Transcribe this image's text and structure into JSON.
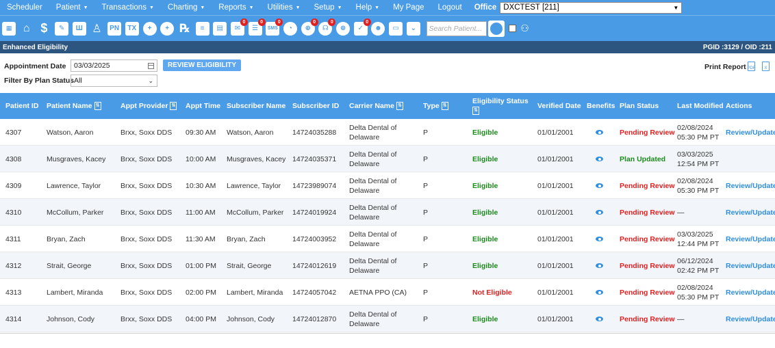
{
  "menu": {
    "items": [
      {
        "label": "Scheduler",
        "caret": false
      },
      {
        "label": "Patient",
        "caret": true
      },
      {
        "label": "Transactions",
        "caret": true
      },
      {
        "label": "Charting",
        "caret": true
      },
      {
        "label": "Reports",
        "caret": true
      },
      {
        "label": "Utilities",
        "caret": true
      },
      {
        "label": "Setup",
        "caret": true
      },
      {
        "label": "Help",
        "caret": true
      },
      {
        "label": "My Page",
        "caret": false
      },
      {
        "label": "Logout",
        "caret": false
      }
    ],
    "office_label": "Office",
    "office_value": "DXCTEST [211]"
  },
  "toolbar": {
    "badge_value": "0",
    "sms_text": "SMS",
    "search_placeholder": "Search Patient..."
  },
  "titlebar": {
    "title": "Enhanced Eligibility",
    "ids": "PGID :3129  /  OID :211"
  },
  "filters": {
    "appointment_date_label": "Appointment Date",
    "appointment_date_value": "03/03/2025",
    "review_button": "REVIEW ELIGIBILITY",
    "plan_status_label": "Filter By Plan Status",
    "plan_status_value": "All",
    "print_report_label": "Print Report"
  },
  "table": {
    "headers": {
      "patient_id": "Patient ID",
      "patient_name": "Patient Name",
      "appt_provider": "Appt Provider",
      "appt_time": "Appt Time",
      "subscriber_name": "Subscriber Name",
      "subscriber_id": "Subscriber ID",
      "carrier_name": "Carrier Name",
      "type": "Type",
      "eligibility_status": "Eligibility Status",
      "verified_date": "Verified Date",
      "benefits": "Benefits",
      "plan_status": "Plan Status",
      "last_modified": "Last Modified",
      "actions": "Actions"
    },
    "rows": [
      {
        "patient_id": "4307",
        "patient_name": "Watson, Aaron",
        "provider": "Brxx, Soxx DDS",
        "time": "09:30 AM",
        "subscriber_name": "Watson, Aaron",
        "subscriber_id": "14724035288",
        "carrier_line1": "Delta Dental of",
        "carrier_line2": "Delaware",
        "type": "P",
        "eligibility": "Eligible",
        "verified": "01/01/2001",
        "plan_status": "Pending Review",
        "modified_line1": "02/08/2024",
        "modified_line2": "05:30 PM PT",
        "action": "Review/Update"
      },
      {
        "patient_id": "4308",
        "patient_name": "Musgraves, Kacey",
        "provider": "Brxx, Soxx DDS",
        "time": "10:00 AM",
        "subscriber_name": "Musgraves, Kacey",
        "subscriber_id": "14724035371",
        "carrier_line1": "Delta Dental of",
        "carrier_line2": "Delaware",
        "type": "P",
        "eligibility": "Eligible",
        "verified": "01/01/2001",
        "plan_status": "Plan Updated",
        "modified_line1": "03/03/2025",
        "modified_line2": "12:54 PM PT",
        "action": ""
      },
      {
        "patient_id": "4309",
        "patient_name": "Lawrence, Taylor",
        "provider": "Brxx, Soxx DDS",
        "time": "10:30 AM",
        "subscriber_name": "Lawrence, Taylor",
        "subscriber_id": "14723989074",
        "carrier_line1": "Delta Dental of",
        "carrier_line2": "Delaware",
        "type": "P",
        "eligibility": "Eligible",
        "verified": "01/01/2001",
        "plan_status": "Pending Review",
        "modified_line1": "02/08/2024",
        "modified_line2": "05:30 PM PT",
        "action": "Review/Update"
      },
      {
        "patient_id": "4310",
        "patient_name": "McCollum, Parker",
        "provider": "Brxx, Soxx DDS",
        "time": "11:00 AM",
        "subscriber_name": "McCollum, Parker",
        "subscriber_id": "14724019924",
        "carrier_line1": "Delta Dental of",
        "carrier_line2": "Delaware",
        "type": "P",
        "eligibility": "Eligible",
        "verified": "01/01/2001",
        "plan_status": "Pending Review",
        "modified_line1": "—",
        "modified_line2": "",
        "action": "Review/Update"
      },
      {
        "patient_id": "4311",
        "patient_name": "Bryan, Zach",
        "provider": "Brxx, Soxx DDS",
        "time": "11:30 AM",
        "subscriber_name": "Bryan, Zach",
        "subscriber_id": "14724003952",
        "carrier_line1": "Delta Dental of",
        "carrier_line2": "Delaware",
        "type": "P",
        "eligibility": "Eligible",
        "verified": "01/01/2001",
        "plan_status": "Pending Review",
        "modified_line1": "03/03/2025",
        "modified_line2": "12:44 PM PT",
        "action": "Review/Update"
      },
      {
        "patient_id": "4312",
        "patient_name": "Strait, George",
        "provider": "Brxx, Soxx DDS",
        "time": "01:00 PM",
        "subscriber_name": "Strait, George",
        "subscriber_id": "14724012619",
        "carrier_line1": "Delta Dental of",
        "carrier_line2": "Delaware",
        "type": "P",
        "eligibility": "Eligible",
        "verified": "01/01/2001",
        "plan_status": "Pending Review",
        "modified_line1": "06/12/2024",
        "modified_line2": "02:42 PM PT",
        "action": "Review/Update"
      },
      {
        "patient_id": "4313",
        "patient_name": "Lambert, Miranda",
        "provider": "Brxx, Soxx DDS",
        "time": "02:00 PM",
        "subscriber_name": "Lambert, Miranda",
        "subscriber_id": "14724057042",
        "carrier_line1": "AETNA PPO (CA)",
        "carrier_line2": "",
        "type": "P",
        "eligibility": "Not Eligible",
        "verified": "01/01/2001",
        "plan_status": "Pending Review",
        "modified_line1": "02/08/2024",
        "modified_line2": "05:30 PM PT",
        "action": "Review/Update"
      },
      {
        "patient_id": "4314",
        "patient_name": "Johnson, Cody",
        "provider": "Brxx, Soxx DDS",
        "time": "04:00 PM",
        "subscriber_name": "Johnson, Cody",
        "subscriber_id": "14724012870",
        "carrier_line1": "Delta Dental of",
        "carrier_line2": "Delaware",
        "type": "P",
        "eligibility": "Eligible",
        "verified": "01/01/2001",
        "plan_status": "Pending Review",
        "modified_line1": "—",
        "modified_line2": "",
        "action": "Review/Update"
      }
    ]
  },
  "colors": {
    "menu_blue": "#4a9be6",
    "title_navy": "#2c5580",
    "eligible_green": "#1a8a1a",
    "alert_red": "#e02020",
    "link_blue": "#2f8ee0"
  }
}
